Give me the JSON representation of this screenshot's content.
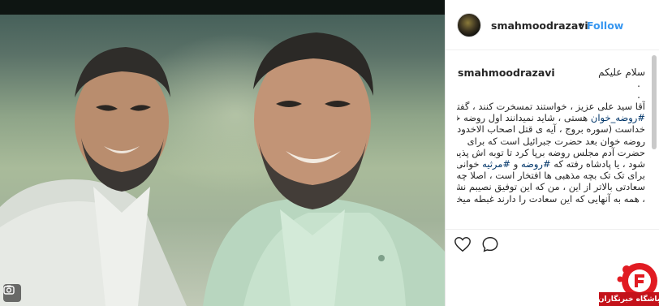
{
  "post": {
    "username": "smahmoodrazavi",
    "follow_label": "Follow",
    "separator": "•"
  },
  "caption": {
    "greeting": "سلام علیکم",
    "dot1": ".",
    "dot2": ".",
    "lines": [
      "آقا سید علی عزیز ، خواستند تمسخرت کنند ، گفتند",
      "#روضه_خوان هستی ، شاید نمیدانند اول روضه خوان",
      "خداست (سوره بروج ، آیه ی قتل اصحاب الاخدود) و",
      "روضه خوان بعد حضرت جبرائیل است که برای",
      "حضرت آدم مجلس روضه برپا کرد تا توبه اش پذیرفته",
      "شود ، یا پادشاه رفته که #روضه و #مرثیه خوانی",
      "برای تک تک بچه مذهبی ها افتخار است ، اصلا چه",
      "سعادتی بالاتر از این ، من که این توفیق نصیبم نشده اما",
      "، همه به آنهایی که این سعادت را دارند غبطه میخورم"
    ]
  },
  "icons": {
    "media_corner": "camera-icon",
    "like": "heart-icon",
    "comment": "comment-icon"
  },
  "watermark": {
    "label": "باشگاه خبرنگاران"
  },
  "colors": {
    "link": "#3897f0",
    "hashtag": "#003569",
    "watermark_red": "#c4121a"
  }
}
